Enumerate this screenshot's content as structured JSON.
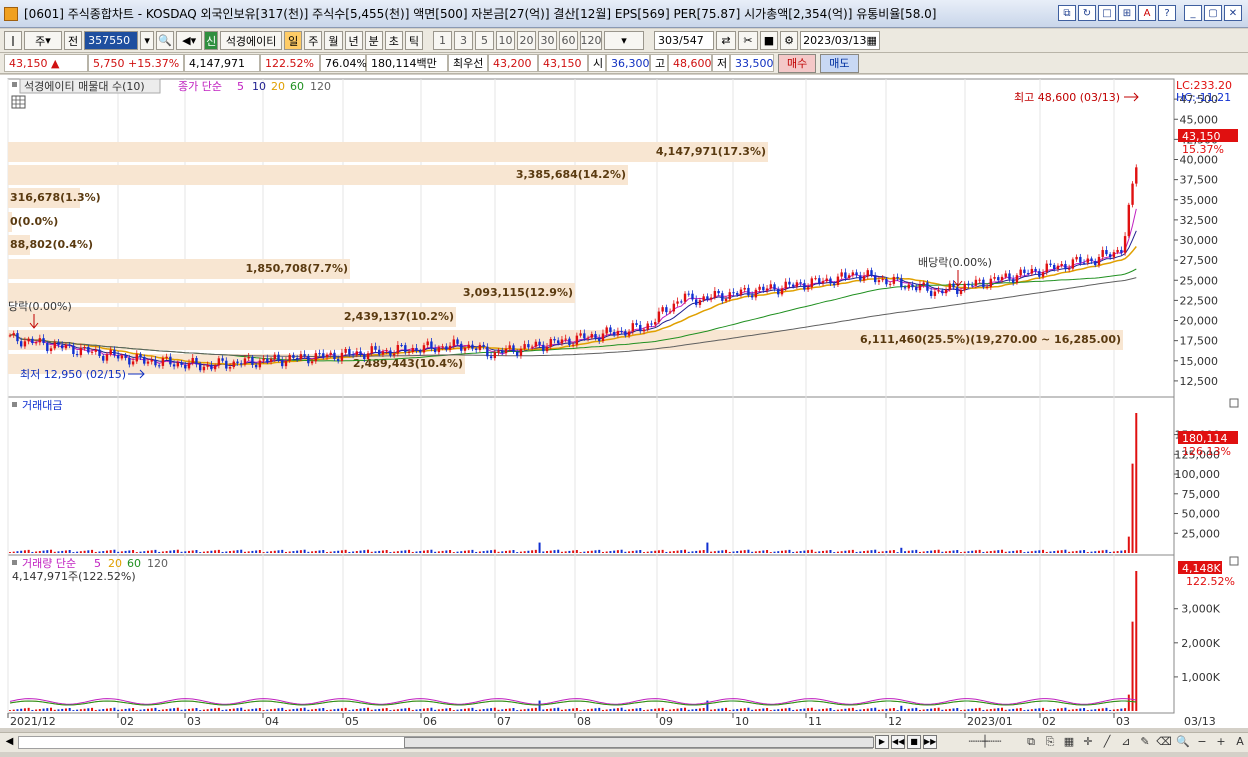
{
  "window": {
    "title": "[0601] 주식종합차트 - KOSDAQ 외국인보유[317(천)] 주식수[5,455(천)] 액면[500] 자본금[27(억)] 결산[12월] EPS[569] PER[75.87] 시가총액[2,354(억)] 유통비율[58.0]"
  },
  "toolbar": {
    "market": "주",
    "prev": "전",
    "code": "357550",
    "stock_name": "석경에이티",
    "period_selected": "일",
    "periods": [
      "주",
      "월",
      "년",
      "분",
      "초",
      "틱"
    ],
    "intervals": [
      "1",
      "3",
      "5",
      "10",
      "20",
      "30",
      "60",
      "120"
    ],
    "count": "303",
    "count_total": "/547",
    "date": "2023/03/13"
  },
  "quote": {
    "price": "43,150",
    "change": "5,750",
    "change_pct": "+15.37%",
    "volume": "4,147,971",
    "vol_ratio": "122.52%",
    "rate": "76.04%",
    "amount": "180,114백만",
    "best_label": "최우선",
    "best_ask": "43,200",
    "best_bid": "43,150",
    "open_label": "시",
    "open": "36,300",
    "high_label": "고",
    "high": "48,600",
    "low_label": "저",
    "low": "33,500",
    "buy": "매수",
    "sell": "매도"
  },
  "price_panel": {
    "legend_name": "석경에이티 매물대 수(10)",
    "legend_ma": "종가 단순",
    "ma_labels": [
      "5",
      "10",
      "20",
      "60",
      "120"
    ],
    "lc": "LC:233.20",
    "hc": "HC:-11.21",
    "last_price": "43,150",
    "last_pct": "15.37%",
    "high_note": "최고 48,600 (03/13)",
    "low_note": "최저 12,950 (02/15)",
    "div_left": "당락(0.00%)",
    "div_right": "배당락(0.00%)",
    "y_ticks": [
      "47,500",
      "45,000",
      "42,500",
      "40,000",
      "37,500",
      "35,000",
      "32,500",
      "30,000",
      "27,500",
      "25,000",
      "22,500",
      "20,000",
      "17,500",
      "15,000",
      "12,500"
    ],
    "volume_profile": [
      {
        "label": "4,147,971(17.3%)",
        "w": 760
      },
      {
        "label": "3,385,684(14.2%)",
        "w": 620
      },
      {
        "label": "316,678(1.3%)",
        "w": 72
      },
      {
        "label": "0(0.0%)",
        "w": 4
      },
      {
        "label": "88,802(0.4%)",
        "w": 22
      },
      {
        "label": "1,850,708(7.7%)",
        "w": 342
      },
      {
        "label": "3,093,115(12.9%)",
        "w": 567
      },
      {
        "label": "2,439,137(10.2%)",
        "w": 448
      },
      {
        "label": "6,111,460(25.5%)(19,270.00 ~ 16,285.00)",
        "w": 1115
      },
      {
        "label": "2,489,443(10.4%)",
        "w": 457
      }
    ]
  },
  "amount_panel": {
    "legend": "거래대금",
    "last": "180,114",
    "pct": "126.13%",
    "y_ticks": [
      "150,000",
      "125,000",
      "100,000",
      "75,000",
      "50,000",
      "25,000"
    ]
  },
  "volume_panel": {
    "legend": "거래량 단순",
    "ma_labels": [
      "5",
      "20",
      "60",
      "120"
    ],
    "info": "4,147,971주(122.52%)",
    "last": "4,148K",
    "pct": "122.52%",
    "y_ticks": [
      "3,000K",
      "2,000K",
      "1,000K"
    ]
  },
  "xaxis": {
    "labels": [
      "2021/12",
      "02",
      "03",
      "04",
      "05",
      "06",
      "07",
      "08",
      "09",
      "10",
      "11",
      "12",
      "2023/01",
      "02",
      "03"
    ],
    "last_date": "03/13"
  },
  "colors": {
    "up": "#e01010",
    "down": "#1030d0",
    "ma5": "#c020c0",
    "ma10": "#202090",
    "ma20": "#e0a000",
    "ma60": "#209020",
    "ma120": "#606060",
    "profile": "#f8e6d2"
  }
}
